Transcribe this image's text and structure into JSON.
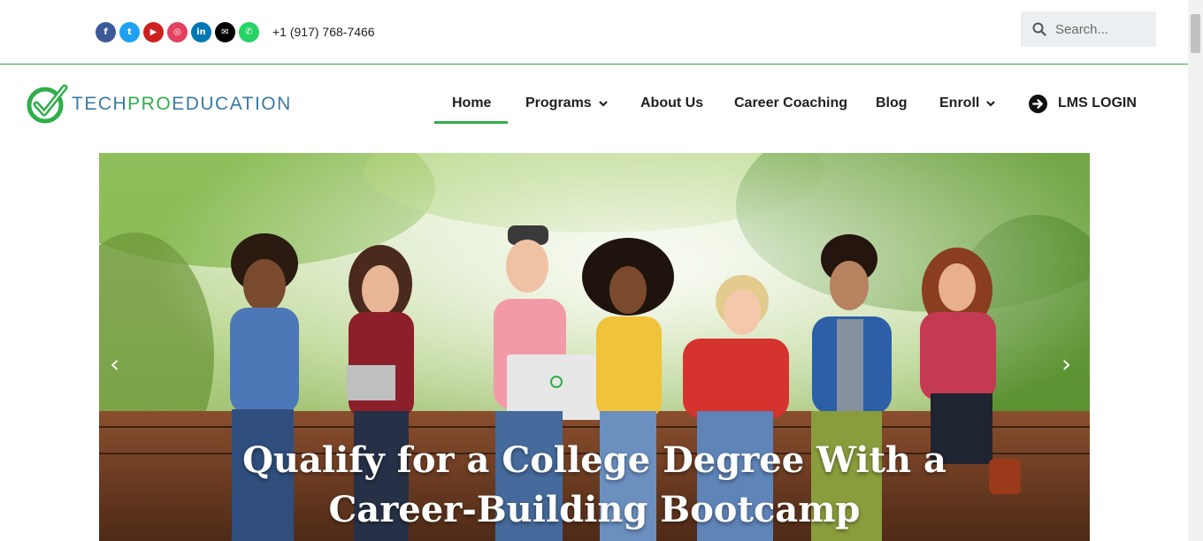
{
  "topbar": {
    "social_icons": [
      {
        "name": "facebook-icon",
        "glyph": "f",
        "color": "#3b5998"
      },
      {
        "name": "twitter-icon",
        "glyph": "t",
        "color": "#1da1f2"
      },
      {
        "name": "youtube-icon",
        "glyph": "▶",
        "color": "#cd201f"
      },
      {
        "name": "instagram-icon",
        "glyph": "◎",
        "color": "#e4405f"
      },
      {
        "name": "linkedin-icon",
        "glyph": "in",
        "color": "#0077b5"
      },
      {
        "name": "email-icon",
        "glyph": "✉",
        "color": "#000000"
      },
      {
        "name": "whatsapp-icon",
        "glyph": "✆",
        "color": "#25d366"
      }
    ],
    "phone": "+1 (917) 768-7466",
    "search": {
      "placeholder": "Search..."
    }
  },
  "header": {
    "logo_text_a": "TECH",
    "logo_text_b": "PRO",
    "logo_text_c": "EDUCATION",
    "nav": [
      {
        "label": "Home",
        "active": true,
        "has_dropdown": false
      },
      {
        "label": "Programs",
        "active": false,
        "has_dropdown": true
      },
      {
        "label": "About Us",
        "active": false,
        "has_dropdown": false
      },
      {
        "label": "Career Coaching",
        "active": false,
        "has_dropdown": false
      },
      {
        "label": "Blog",
        "active": false,
        "has_dropdown": false
      },
      {
        "label": "Enroll",
        "active": false,
        "has_dropdown": true
      }
    ],
    "lms_login": "LMS LOGIN"
  },
  "hero": {
    "title_line1": "Qualify for a College Degree With a",
    "title_line2": "Career-Building Bootcamp",
    "prev_arrow": "‹",
    "next_arrow": "›"
  },
  "colors": {
    "brand_green": "#2fae4a",
    "brand_blue": "#3a7aa0"
  }
}
